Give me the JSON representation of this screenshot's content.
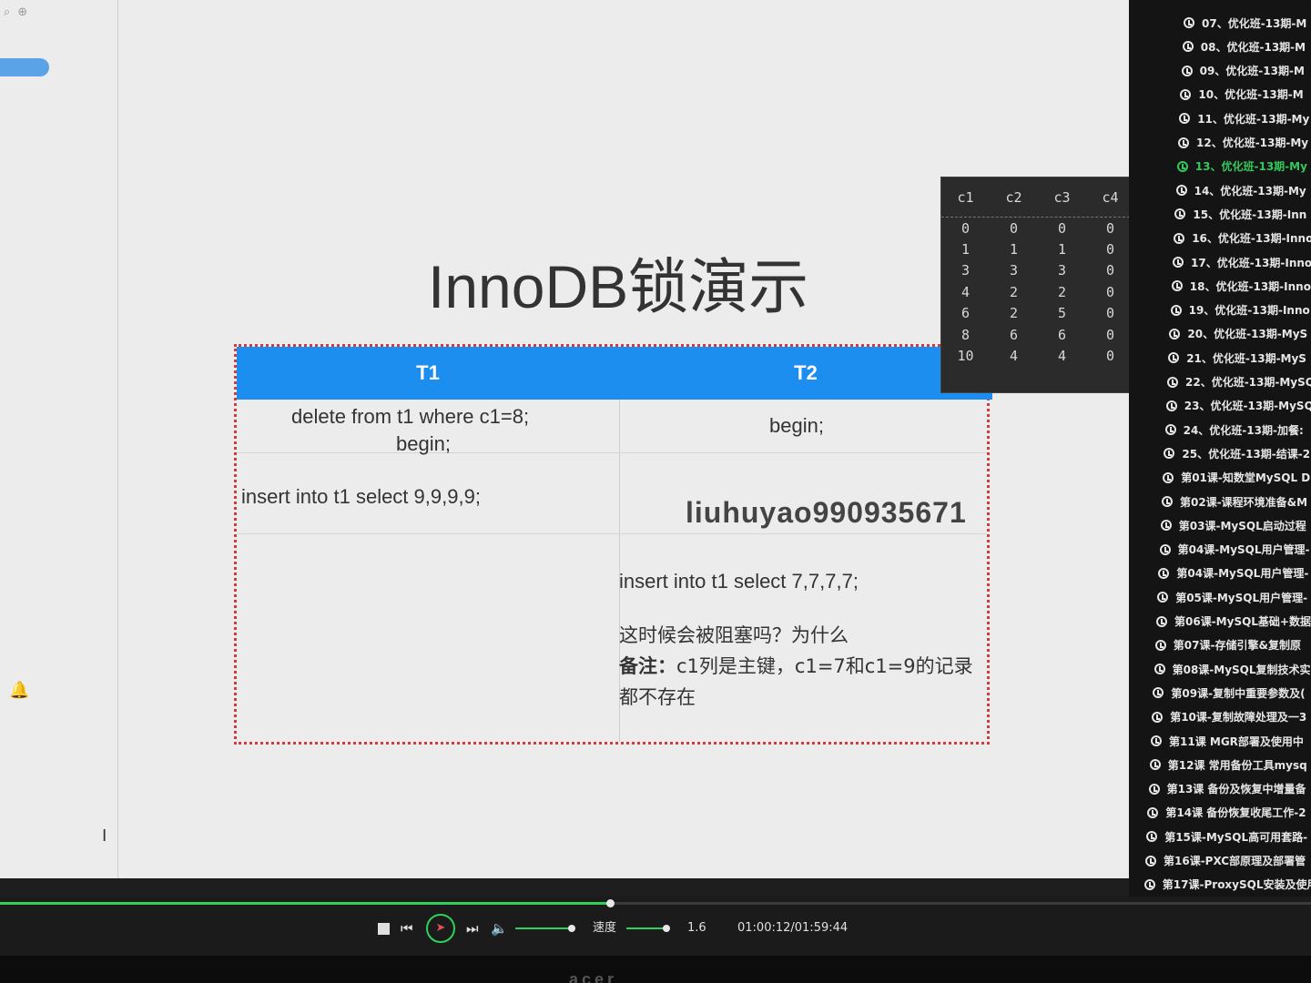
{
  "left_panel": {
    "tag": "",
    "icons": [
      "search-icon",
      "zoom-icon"
    ]
  },
  "slide": {
    "title": "InnoDB锁演示",
    "table": {
      "col1_header": "T1",
      "col2_header": "T2",
      "t1_step1_line1": "delete from t1 where c1=8;",
      "t1_step1_line2": "begin;",
      "t2_step1": "begin;",
      "t1_step2": "insert into t1 select 9,9,9,9;",
      "t2_step3": "insert into t1 select 7,7,7,7;",
      "question": "这时候会被阻塞吗？为什么",
      "note_label": "备注：",
      "note_text": "c1列是主键，c1=7和c1=9的记录都不存在"
    },
    "user_watermark": "liuhuyao990935671"
  },
  "result_table": {
    "headers": [
      "c1",
      "c2",
      "c3",
      "c4"
    ],
    "rows": [
      [
        "0",
        "0",
        "0",
        "0"
      ],
      [
        "1",
        "1",
        "1",
        "0"
      ],
      [
        "3",
        "3",
        "3",
        "0"
      ],
      [
        "4",
        "2",
        "2",
        "0"
      ],
      [
        "6",
        "2",
        "5",
        "0"
      ],
      [
        "8",
        "6",
        "6",
        "0"
      ],
      [
        "10",
        "4",
        "4",
        "0"
      ]
    ]
  },
  "playlist": {
    "items": [
      {
        "label": "07、优化班-13期-M",
        "active": false
      },
      {
        "label": "08、优化班-13期-M",
        "active": false
      },
      {
        "label": "09、优化班-13期-M",
        "active": false
      },
      {
        "label": "10、优化班-13期-M",
        "active": false
      },
      {
        "label": "11、优化班-13期-My",
        "active": false
      },
      {
        "label": "12、优化班-13期-My",
        "active": false
      },
      {
        "label": "13、优化班-13期-My",
        "active": true
      },
      {
        "label": "14、优化班-13期-My",
        "active": false
      },
      {
        "label": "15、优化班-13期-Inn",
        "active": false
      },
      {
        "label": "16、优化班-13期-Inno",
        "active": false
      },
      {
        "label": "17、优化班-13期-Inno",
        "active": false
      },
      {
        "label": "18、优化班-13期-Inno",
        "active": false
      },
      {
        "label": "19、优化班-13期-Inno",
        "active": false
      },
      {
        "label": "20、优化班-13期-MyS",
        "active": false
      },
      {
        "label": "21、优化班-13期-MyS",
        "active": false
      },
      {
        "label": "22、优化班-13期-MySQ",
        "active": false
      },
      {
        "label": "23、优化班-13期-MySQ",
        "active": false
      },
      {
        "label": "24、优化班-13期-加餐:",
        "active": false
      },
      {
        "label": "25、优化班-13期-结课-2",
        "active": false
      },
      {
        "label": "第01课-知数堂MySQL D",
        "active": false
      },
      {
        "label": "第02课-课程环境准备&M",
        "active": false
      },
      {
        "label": "第03课-MySQL启动过程",
        "active": false
      },
      {
        "label": "第04课-MySQL用户管理-",
        "active": false
      },
      {
        "label": "第04课-MySQL用户管理-",
        "active": false
      },
      {
        "label": "第05课-MySQL用户管理-",
        "active": false
      },
      {
        "label": "第06课-MySQL基础+数据",
        "active": false
      },
      {
        "label": "第07课-存储引擎&复制原",
        "active": false
      },
      {
        "label": "第08课-MySQL复制技术实",
        "active": false
      },
      {
        "label": "第09课-复制中重要参数及(",
        "active": false
      },
      {
        "label": "第10课-复制故障处理及一3",
        "active": false
      },
      {
        "label": "第11课 MGR部署及使用中",
        "active": false
      },
      {
        "label": "第12课 常用备份工具mysq",
        "active": false
      },
      {
        "label": "第13课 备份及恢复中增量备",
        "active": false
      },
      {
        "label": "第14课 备份恢复收尾工作-2",
        "active": false
      },
      {
        "label": "第15课-MySQL高可用套路-",
        "active": false
      },
      {
        "label": "第16课-PXC部原理及部署管",
        "active": false
      },
      {
        "label": "第17课-ProxySQL安装及使用",
        "active": false
      }
    ]
  },
  "player": {
    "progress_fraction": 0.5,
    "volume_fraction": 0.95,
    "speed_label": "速度",
    "speed_value": "1.6",
    "time_display": "01:00:12/01:59:44",
    "speed_fraction": 0.65,
    "icons": [
      "stop-icon",
      "prev-icon",
      "play-icon",
      "next-icon",
      "volume-icon"
    ]
  },
  "bezel": {
    "brand": "acer"
  }
}
